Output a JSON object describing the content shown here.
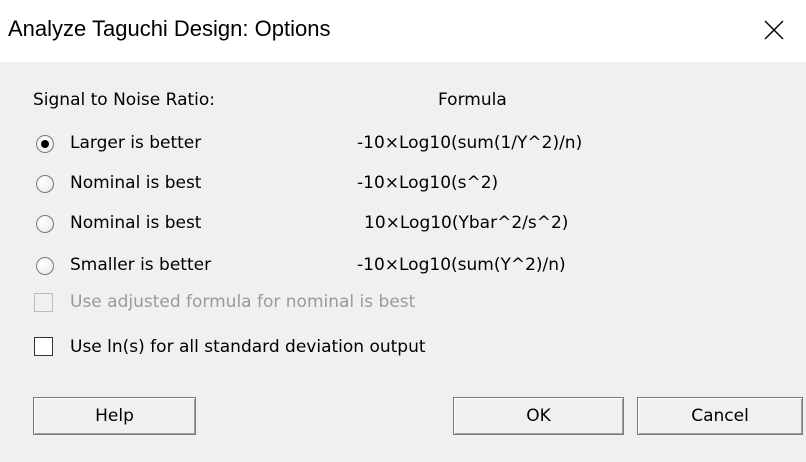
{
  "window": {
    "title": "Analyze Taguchi Design: Options",
    "close_icon": "close-icon"
  },
  "signal_to_noise": {
    "label": "Signal to Noise Ratio:",
    "formula_header": "Formula",
    "options": [
      {
        "label": "Larger is better",
        "formula": "-10×Log10(sum(1/Y^2)/n)",
        "selected": true
      },
      {
        "label": "Nominal is best",
        "formula": "-10×Log10(s^2)",
        "selected": false
      },
      {
        "label": "Nominal is best",
        "formula": "10×Log10(Ybar^2/s^2)",
        "selected": false
      },
      {
        "label": "Smaller is better",
        "formula": "-10×Log10(sum(Y^2)/n)",
        "selected": false
      }
    ]
  },
  "checkboxes": {
    "adjusted_formula": {
      "label": "Use adjusted formula for nominal is best",
      "checked": false,
      "enabled": false
    },
    "use_ln_s": {
      "label": "Use ln(s) for all standard deviation output",
      "checked": false,
      "enabled": true
    }
  },
  "buttons": {
    "help": "Help",
    "ok": "OK",
    "cancel": "Cancel"
  }
}
